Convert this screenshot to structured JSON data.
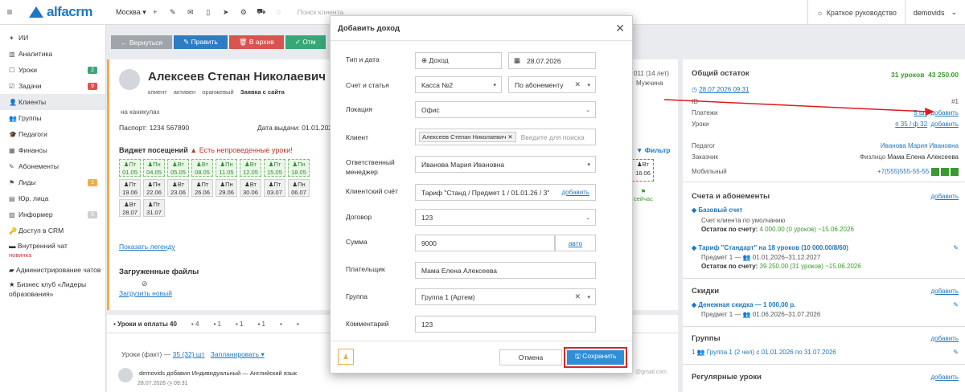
{
  "topbar": {
    "brand": "alfacrm",
    "branch": "Москва ▾",
    "search_placeholder": "Поиск клиента",
    "guide": "Краткое руководство",
    "user": "demovids"
  },
  "sidebar": {
    "items": [
      {
        "icon": "✦",
        "label": "ИИ"
      },
      {
        "icon": "▥",
        "label": "Аналитика"
      },
      {
        "icon": "☐",
        "label": "Уроки",
        "badge": "2",
        "badge_color": "#3aa57a"
      },
      {
        "icon": "☑",
        "label": "Задачи",
        "badge": "9",
        "badge_color": "#d9534f"
      },
      {
        "icon": "👤",
        "label": "Клиенты"
      },
      {
        "icon": "👥",
        "label": "Группы"
      },
      {
        "icon": "🎓",
        "label": "Педагоги"
      },
      {
        "icon": "▦",
        "label": "Финансы"
      },
      {
        "icon": "✎",
        "label": "Абонементы"
      },
      {
        "icon": "⚑",
        "label": "Лиды",
        "badge": "1",
        "badge_color": "#f0ad4e"
      },
      {
        "icon": "▤",
        "label": "Юр. лица"
      },
      {
        "icon": "▨",
        "label": "Информер",
        "badge": "5",
        "badge_color": "#cfcfcf"
      },
      {
        "icon": "🔑",
        "label": "Доступ в CRM"
      }
    ],
    "chat": "Внутренний чат",
    "chat_new": "новинка",
    "admin": "Администрирование чатов",
    "club": "Бизнес клуб «Лидеры образования»"
  },
  "actions": {
    "back": "← Вернуться",
    "edit": "✎ Править",
    "archive": "🗑 В архив",
    "other": "✓ Отм"
  },
  "client": {
    "name": "Алексеев Степан Николаевич",
    "tags": [
      "клиент",
      "активен",
      "оранжевый",
      "Заявка с сайта"
    ],
    "holiday": "на каникулах",
    "passport": "Паспорт: 1234 567890",
    "issue": "Дата выдачи: 01.01.202",
    "age": "011 (14 лет)",
    "gender": "Мужчина"
  },
  "widget": {
    "title": "Виджет посещений",
    "warning": "Есть непроведенные уроки!",
    "filter": "Фильтр",
    "days": [
      {
        "d": "Пт",
        "dt": "01.05"
      },
      {
        "d": "Пн",
        "dt": "04.05"
      },
      {
        "d": "Вт",
        "dt": "05.05"
      },
      {
        "d": "Вт",
        "dt": "08.05"
      },
      {
        "d": "Пн",
        "dt": "11.05"
      },
      {
        "d": "Вт",
        "dt": "12.05"
      },
      {
        "d": "Пт",
        "dt": "15.05"
      },
      {
        "d": "Пн",
        "dt": "18.05"
      },
      {
        "d": "Пт",
        "dt": "19.06"
      },
      {
        "d": "Пн",
        "dt": "22.06"
      },
      {
        "d": "Вт",
        "dt": "23.06"
      },
      {
        "d": "Пт",
        "dt": "26.06"
      },
      {
        "d": "Пн",
        "dt": "29.06"
      },
      {
        "d": "Вт",
        "dt": "30.06"
      },
      {
        "d": "Пт",
        "dt": "03.07"
      },
      {
        "d": "Пн",
        "dt": "06.07"
      },
      {
        "d": "Вт",
        "dt": "28.07"
      },
      {
        "d": "Пт",
        "dt": "31.07"
      }
    ],
    "side_day": {
      "d": "Вт",
      "dt": "16.06"
    },
    "today": "сейчас",
    "legend": "Показать легенду"
  },
  "files": {
    "title": "Загруженные файлы",
    "upload": "Загрузить новый"
  },
  "tabs": [
    {
      "label": "Уроки и оплаты 40"
    },
    {
      "label": "4"
    },
    {
      "label": "1"
    },
    {
      "label": "1"
    },
    {
      "label": "1"
    },
    {
      "label": ""
    },
    {
      "label": ""
    }
  ],
  "lessons": {
    "prefix": "Уроки (факт) —",
    "fact": "35 (32) шт",
    "plan": "Запланировать ▾"
  },
  "entry": {
    "text": "demovids добавил Индивидуальный — Английский язык",
    "date": "28.07.2026 ◷ 09:31",
    "right": "@gmail.com"
  },
  "right": {
    "balance_title": "Общий остаток",
    "balance_lessons": "31 уроков",
    "balance_sum": "43 250.00",
    "balance_date": "28.07.2026 09:31",
    "id_label": "ID",
    "id_value": "#1",
    "payments_label": "Платежи",
    "payments_value": "5 шт",
    "lessons_label": "Уроки",
    "lessons_value": "п 35 / ф 32",
    "add": "добавить",
    "teacher_label": "Педагог",
    "teacher": "Иванова Мария Ивановна",
    "customer_label": "Заказчик",
    "customer_prefix": "Физлицо",
    "customer": "Мама Елена Алексеева",
    "mobile_label": "Мобильный",
    "mobile": "+7(555)555-55-55",
    "accounts_title": "Счета и абонементы",
    "base_account": "Базовый счет",
    "base_desc": "Счет клиента по умолчанию",
    "base_rest_label": "Остаток по счету:",
    "base_rest": "4 000.00 (0 уроков) ~15.06.2026",
    "tariff": "Тариф \"Стандарт\" на 18 уроков (10 000.00/8/60)",
    "tariff_subject": "Предмет 1 — 👥 01.01.2026–31.12.2027",
    "tariff_rest_label": "Остаток по счету:",
    "tariff_rest": "39 250.00 (31 уроков) ~15.06.2026",
    "discounts_title": "Скидки",
    "discount": "Денежная скидка — 1 000,00 р.",
    "discount_subject": "Предмет 1 — 👥 01.06.2026–31.07.2026",
    "groups_title": "Группы",
    "group": "1 👥 Группа 1 (2 чел) с 01.01.2026 по 31.07.2026",
    "regular_title": "Регулярные уроки"
  },
  "modal": {
    "title": "Добавить доход",
    "labels": {
      "type_date": "Тип и дата",
      "account": "Счет и статья",
      "location": "Локация",
      "client": "Клиент",
      "manager": "Ответственный менеджер",
      "client_account": "Клиентский счёт",
      "contract": "Договор",
      "sum": "Сумма",
      "payer": "Плательщик",
      "group": "Группа",
      "comment": "Комментарий"
    },
    "values": {
      "type": "⊕ Доход",
      "date": "28.07.2026",
      "cash": "Касса №2",
      "article": "По абонементу",
      "location": "Офис",
      "client_chip": "Алексеев Степан Николаевич",
      "client_placeholder": "Введите для поиска",
      "manager": "Иванова Мария Ивановна",
      "client_account": "Тариф \"Станд / Предмет 1 / 01.01.26 / 3\"",
      "client_account_add": "добавить",
      "contract": "123",
      "sum": "9000",
      "sum_auto": "авто",
      "payer": "Мама Елена Алексеева",
      "group": "Группа 1 (Артем)",
      "comment": "123"
    },
    "cancel": "Отмена",
    "save": "🖫 Сохранить"
  }
}
